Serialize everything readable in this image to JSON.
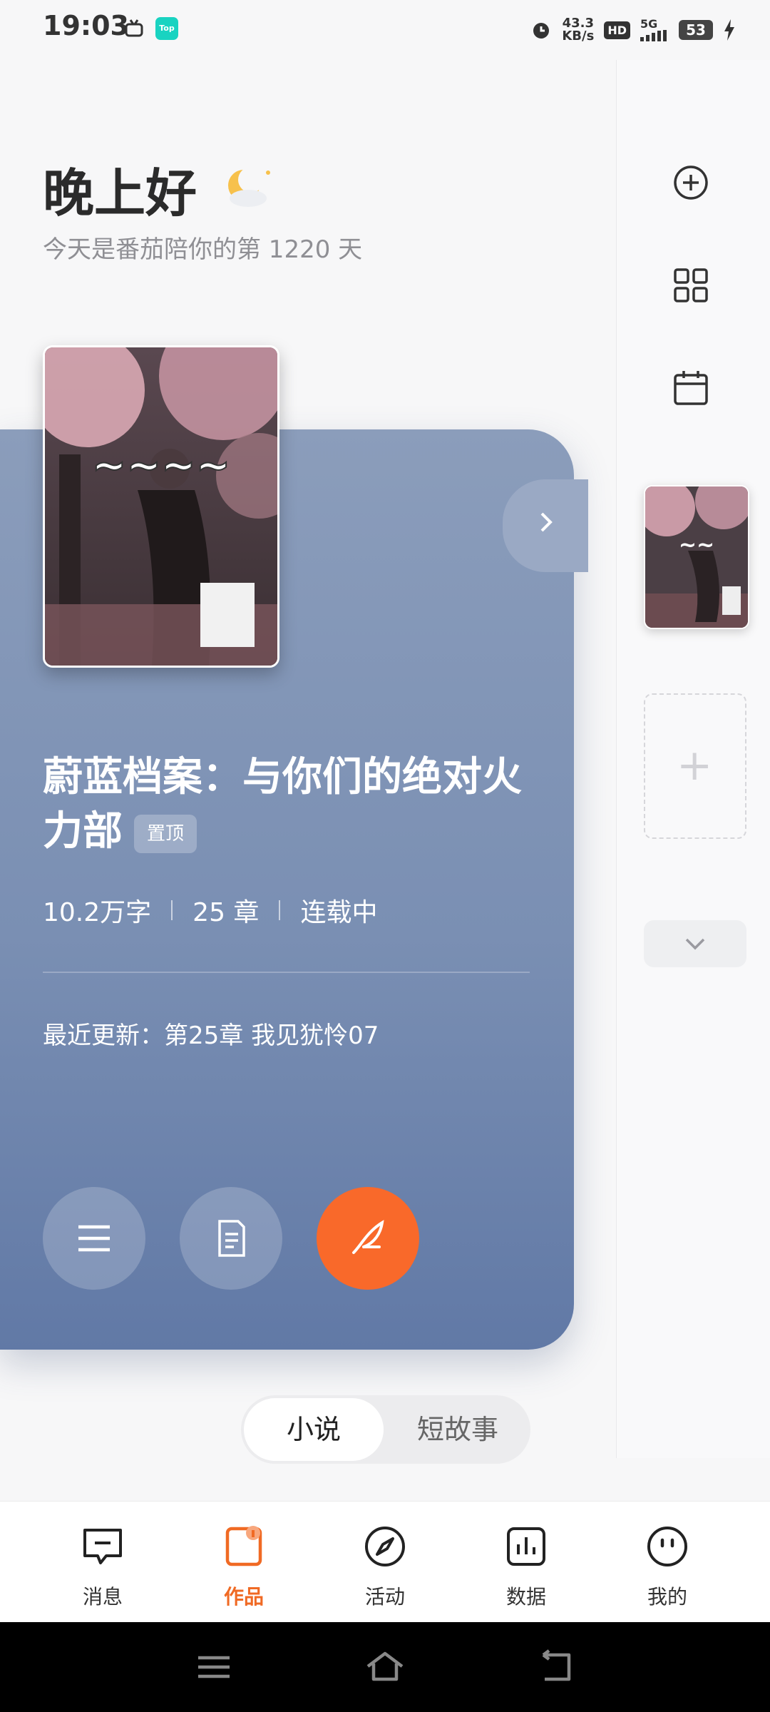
{
  "status": {
    "time": "19:03",
    "top_app": "Top",
    "net_speed_value": "43.3",
    "net_speed_unit": "KB/s",
    "hd": "HD",
    "network": "5G",
    "battery": "53"
  },
  "greeting": {
    "title": "晚上好",
    "days_text": "今天是番茄陪你的第 1220 天"
  },
  "book": {
    "title": "蔚蓝档案：与你们的绝对火力部",
    "pin_label": "置顶",
    "word_count": "10.2万字",
    "chapters": "25 章",
    "status": "连载中",
    "latest_update": "最近更新：第25章 我见犹怜07"
  },
  "tabs": {
    "novel": "小说",
    "short_story": "短故事"
  },
  "nav": [
    {
      "label": "消息",
      "icon": "message-icon",
      "active": false
    },
    {
      "label": "作品",
      "icon": "works-icon",
      "active": true
    },
    {
      "label": "活动",
      "icon": "compass-icon",
      "active": false
    },
    {
      "label": "数据",
      "icon": "chart-icon",
      "active": false
    },
    {
      "label": "我的",
      "icon": "profile-icon",
      "active": false
    }
  ],
  "colors": {
    "accent": "#f9692a",
    "card": "#7a8fb3",
    "active_nav": "#f06a24"
  }
}
